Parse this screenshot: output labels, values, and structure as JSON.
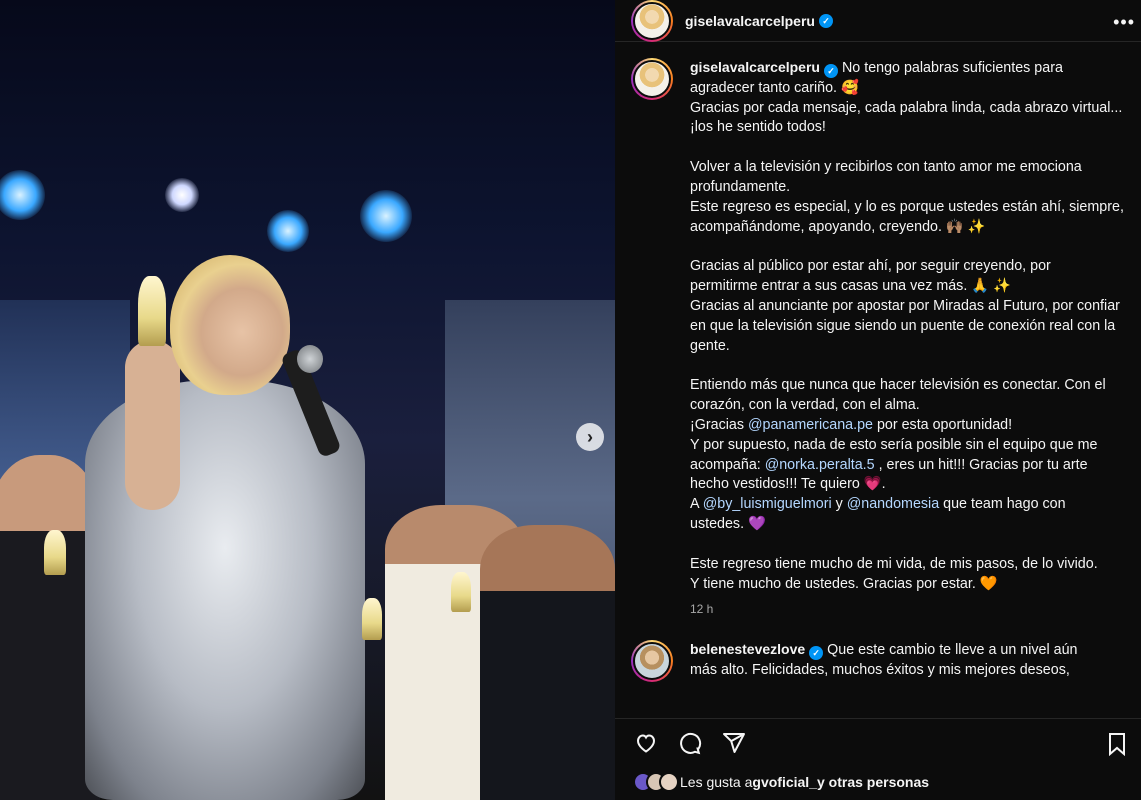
{
  "media": {
    "next_glyph": "›"
  },
  "post": {
    "username": "giselavalcarcelperu",
    "verified_glyph": "✓",
    "more_glyph": "•••",
    "caption_lines": [
      [
        "No tengo palabras suficientes para"
      ],
      [
        "agradecer tanto cariño. 🥰"
      ],
      [
        "Gracias por cada mensaje, cada palabra linda, cada abrazo virtual..."
      ],
      [
        "¡los he sentido todos!"
      ],
      [],
      [
        "Volver a la televisión y recibirlos con tanto amor me emociona"
      ],
      [
        "profundamente."
      ],
      [
        "Este regreso es especial, y lo es porque ustedes están ahí, siempre,"
      ],
      [
        "acompañándome, apoyando, creyendo. 🙌🏽 ✨"
      ],
      [],
      [
        "Gracias al público por estar ahí, por seguir creyendo, por"
      ],
      [
        "permitirme entrar a sus casas una vez más. 🙏 ✨"
      ],
      [
        "Gracias al anunciante por apostar por Miradas al Futuro, por confiar"
      ],
      [
        "en que la televisión sigue siendo un puente de conexión real con la"
      ],
      [
        "gente."
      ],
      [],
      [
        "Entiendo más que nunca que hacer televisión es conectar. Con el"
      ],
      [
        "corazón, con la verdad, con el alma."
      ],
      [
        "¡Gracias ",
        "@panamericana.pe",
        " por esta oportunidad!"
      ],
      [
        "Y por supuesto, nada de esto sería posible sin el equipo que me"
      ],
      [
        "acompaña: ",
        "@norka.peralta.5",
        " , eres un hit!!! Gracias por tu arte"
      ],
      [
        "hecho vestidos!!! Te quiero 💗."
      ],
      [
        "A ",
        "@by_luismiguelmori",
        " y ",
        "@nandomesia",
        " que team hago con"
      ],
      [
        "ustedes. 💜"
      ],
      [],
      [
        "Este regreso tiene mucho de mi vida, de mis pasos, de lo vivido."
      ],
      [
        "Y tiene mucho de ustedes. Gracias por estar. 🧡"
      ]
    ],
    "time_ago": "12 h"
  },
  "comment": {
    "username": "belenestevezlove",
    "line1": "Que este cambio te lleve a un nivel aún",
    "line2": "más alto. Felicidades, muchos éxitos y mis mejores deseos,"
  },
  "likes": {
    "prefix": "Les gusta a ",
    "user": "gvoficial_",
    "suffix": " y otras personas"
  },
  "icons": [
    "like-icon",
    "comment-icon",
    "share-icon",
    "save-icon",
    "more-icon",
    "next-icon",
    "verified-icon"
  ],
  "colors": {
    "accent": "#0095f6",
    "panel_bg": "#0c0c0c",
    "mention": "#b4d7ff",
    "muted": "#a8a8a8"
  }
}
